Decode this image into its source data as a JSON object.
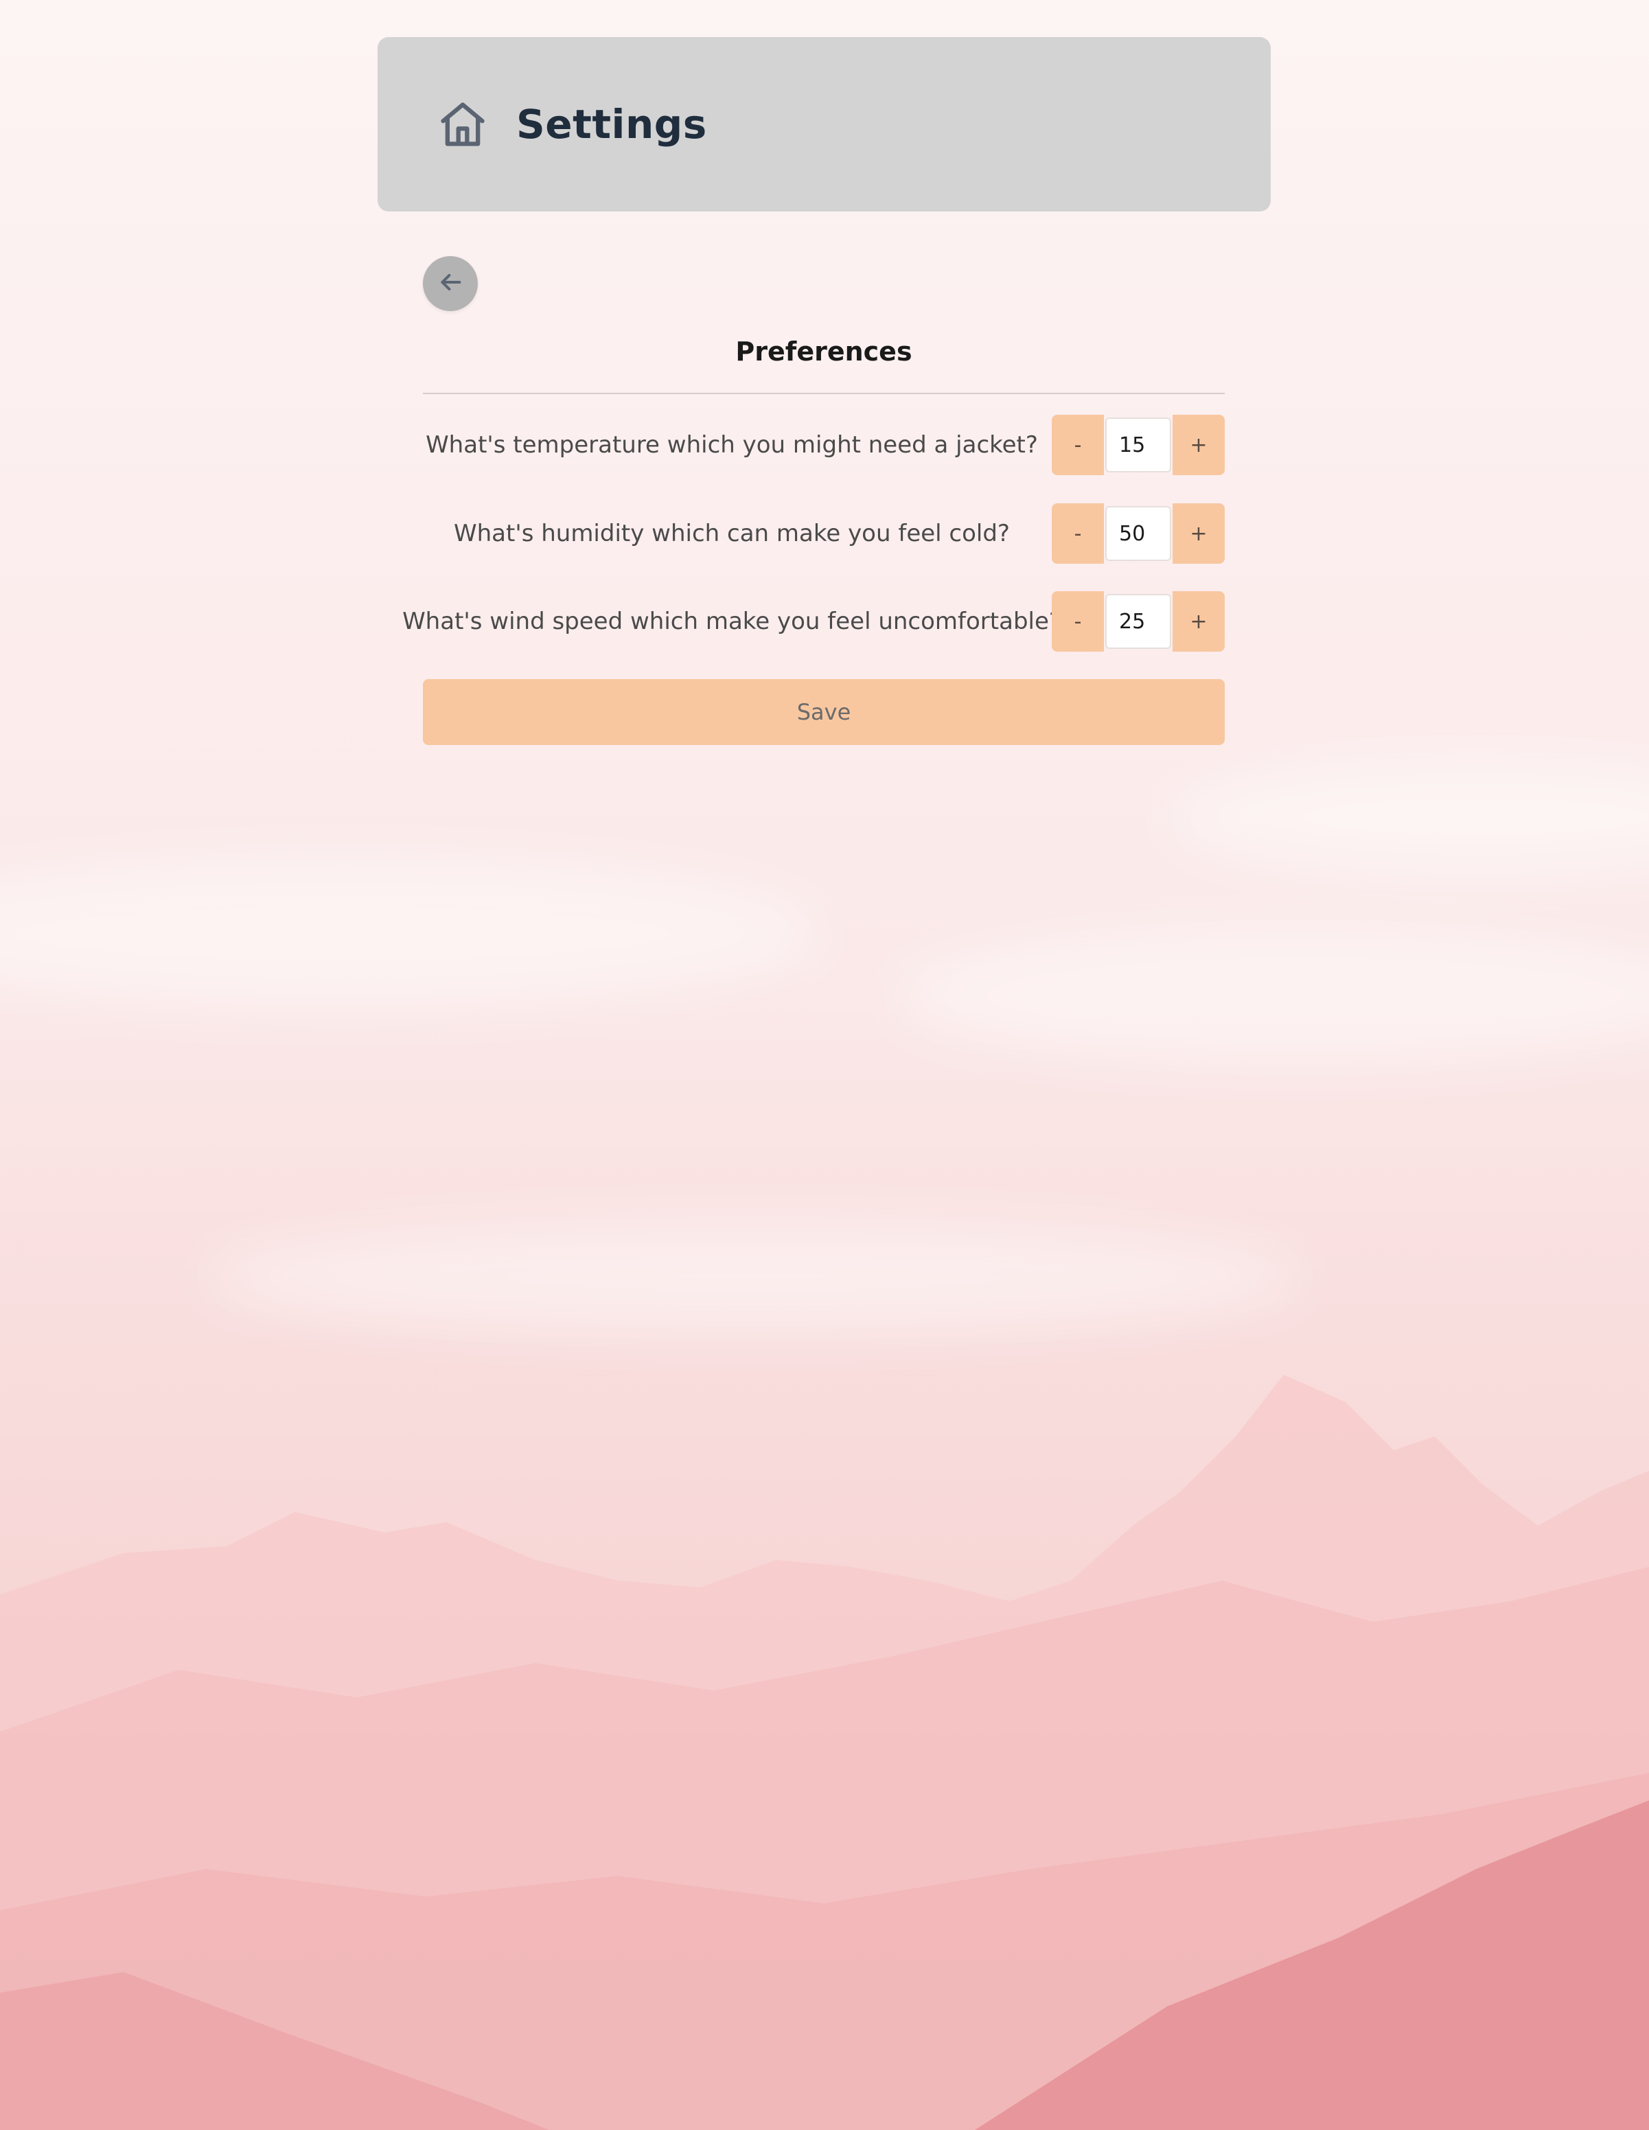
{
  "header": {
    "title": "Settings",
    "icon": "home-icon"
  },
  "back_button": {
    "icon": "arrow-left-icon"
  },
  "preferences": {
    "title": "Preferences",
    "items": [
      {
        "label": "What's temperature which you might need a jacket?",
        "value": "15",
        "decrement": "-",
        "increment": "+"
      },
      {
        "label": "What's humidity which can make you feel cold?",
        "value": "50",
        "decrement": "-",
        "increment": "+"
      },
      {
        "label": "What's wind speed which make you feel uncomfortable?",
        "value": "25",
        "decrement": "-",
        "increment": "+"
      }
    ]
  },
  "save_label": "Save",
  "colors": {
    "header_bg": "#d3d3d3",
    "accent": "#f8c7a0",
    "title_text": "#1f2d3d",
    "back_button_bg": "#b3b3b3"
  }
}
